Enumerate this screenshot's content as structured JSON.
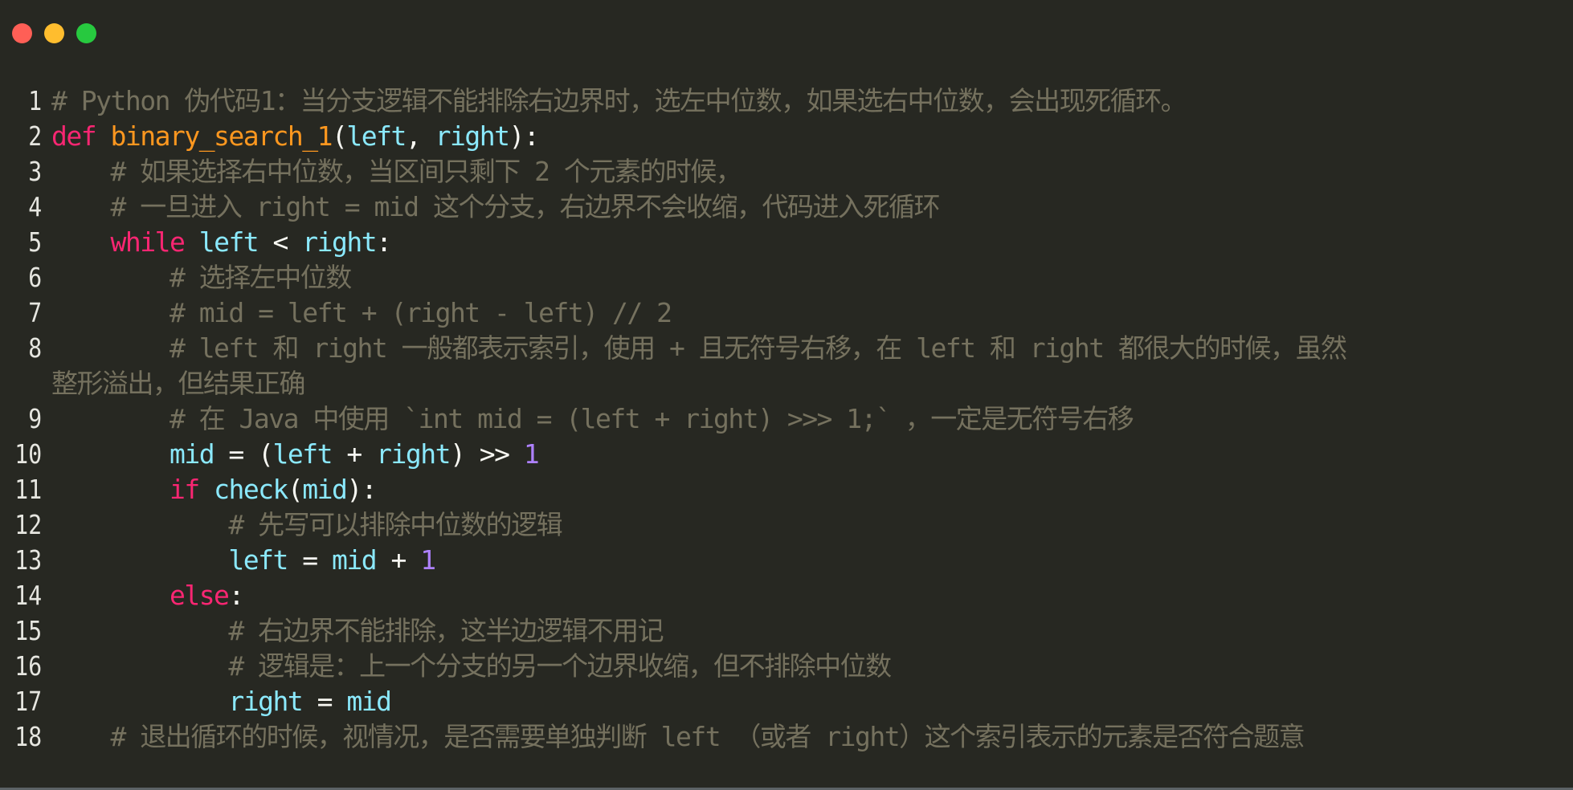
{
  "window": {
    "controls": [
      {
        "name": "close",
        "color": "#ff5f56"
      },
      {
        "name": "minimize",
        "color": "#ffbd2e"
      },
      {
        "name": "maximize",
        "color": "#27c93f"
      }
    ]
  },
  "theme": {
    "background": "#272822",
    "comment": "#75715e",
    "keyword": "#f92672",
    "function": "#fd971f",
    "identifier": "#8be9fd",
    "number": "#ae81ff",
    "operator": "#f8f8f2",
    "line_number": "#e6e6e0"
  },
  "code": {
    "language": "Python",
    "lines": [
      {
        "num": "1",
        "indent": "",
        "tokens": [
          {
            "t": "c",
            "v": "# Python 伪代码1：当分支逻辑不能排除右边界时，选左中位数，如果选右中位数，会出现死循环。"
          }
        ]
      },
      {
        "num": "2",
        "indent": "",
        "tokens": [
          {
            "t": "k",
            "v": "def"
          },
          {
            "t": "o",
            "v": " "
          },
          {
            "t": "f",
            "v": "binary_search_1"
          },
          {
            "t": "o",
            "v": "("
          },
          {
            "t": "v",
            "v": "left"
          },
          {
            "t": "o",
            "v": ", "
          },
          {
            "t": "v",
            "v": "right"
          },
          {
            "t": "o",
            "v": "):"
          }
        ]
      },
      {
        "num": "3",
        "indent": "    ",
        "tokens": [
          {
            "t": "c",
            "v": "# 如果选择右中位数，当区间只剩下 2 个元素的时候，"
          }
        ]
      },
      {
        "num": "4",
        "indent": "    ",
        "tokens": [
          {
            "t": "c",
            "v": "# 一旦进入 right = mid 这个分支，右边界不会收缩，代码进入死循环"
          }
        ]
      },
      {
        "num": "5",
        "indent": "    ",
        "tokens": [
          {
            "t": "k",
            "v": "while"
          },
          {
            "t": "o",
            "v": " "
          },
          {
            "t": "v",
            "v": "left"
          },
          {
            "t": "o",
            "v": " < "
          },
          {
            "t": "v",
            "v": "right"
          },
          {
            "t": "o",
            "v": ":"
          }
        ]
      },
      {
        "num": "6",
        "indent": "        ",
        "tokens": [
          {
            "t": "c",
            "v": "# 选择左中位数"
          }
        ]
      },
      {
        "num": "7",
        "indent": "        ",
        "tokens": [
          {
            "t": "c",
            "v": "# mid = left + (right - left) // 2"
          }
        ]
      },
      {
        "num": "8",
        "indent": "        ",
        "tokens": [
          {
            "t": "c",
            "v": "# left 和 right 一般都表示索引，使用 + 且无符号右移，在 left 和 right 都很大的时候，虽然"
          }
        ],
        "continuation": "整形溢出，但结果正确"
      },
      {
        "num": "9",
        "indent": "        ",
        "tokens": [
          {
            "t": "c",
            "v": "# 在 Java 中使用 `int mid = (left + right) >>> 1;` ，一定是无符号右移"
          }
        ]
      },
      {
        "num": "10",
        "indent": "        ",
        "tokens": [
          {
            "t": "v",
            "v": "mid"
          },
          {
            "t": "o",
            "v": " = ("
          },
          {
            "t": "v",
            "v": "left"
          },
          {
            "t": "o",
            "v": " + "
          },
          {
            "t": "v",
            "v": "right"
          },
          {
            "t": "o",
            "v": ") >> "
          },
          {
            "t": "n",
            "v": "1"
          }
        ]
      },
      {
        "num": "11",
        "indent": "        ",
        "tokens": [
          {
            "t": "k",
            "v": "if"
          },
          {
            "t": "o",
            "v": " "
          },
          {
            "t": "v",
            "v": "check"
          },
          {
            "t": "o",
            "v": "("
          },
          {
            "t": "v",
            "v": "mid"
          },
          {
            "t": "o",
            "v": "):"
          }
        ]
      },
      {
        "num": "12",
        "indent": "            ",
        "tokens": [
          {
            "t": "c",
            "v": "# 先写可以排除中位数的逻辑"
          }
        ]
      },
      {
        "num": "13",
        "indent": "            ",
        "tokens": [
          {
            "t": "v",
            "v": "left"
          },
          {
            "t": "o",
            "v": " = "
          },
          {
            "t": "v",
            "v": "mid"
          },
          {
            "t": "o",
            "v": " + "
          },
          {
            "t": "n",
            "v": "1"
          }
        ]
      },
      {
        "num": "14",
        "indent": "        ",
        "tokens": [
          {
            "t": "k",
            "v": "else"
          },
          {
            "t": "o",
            "v": ":"
          }
        ]
      },
      {
        "num": "15",
        "indent": "            ",
        "tokens": [
          {
            "t": "c",
            "v": "# 右边界不能排除，这半边逻辑不用记"
          }
        ]
      },
      {
        "num": "16",
        "indent": "            ",
        "tokens": [
          {
            "t": "c",
            "v": "# 逻辑是：上一个分支的另一个边界收缩，但不排除中位数"
          }
        ]
      },
      {
        "num": "17",
        "indent": "            ",
        "tokens": [
          {
            "t": "v",
            "v": "right"
          },
          {
            "t": "o",
            "v": " = "
          },
          {
            "t": "v",
            "v": "mid"
          }
        ]
      },
      {
        "num": "18",
        "indent": "    ",
        "tokens": [
          {
            "t": "c",
            "v": "# 退出循环的时候，视情况，是否需要单独判断 left （或者 right）这个索引表示的元素是否符合题意"
          }
        ]
      }
    ]
  }
}
